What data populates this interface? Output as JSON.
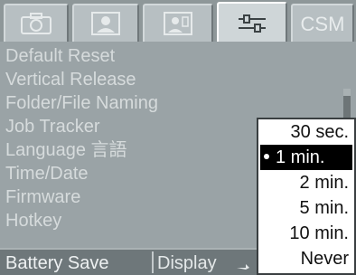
{
  "tabs": [
    {
      "icon": "camera-icon"
    },
    {
      "icon": "portrait-icon"
    },
    {
      "icon": "scene-icon"
    },
    {
      "icon": "settings-icon"
    },
    {
      "label": "CSM"
    }
  ],
  "active_tab": 3,
  "menu": {
    "items": [
      "Default Reset",
      "Vertical Release",
      "Folder/File Naming",
      "Job Tracker",
      "Language 言語",
      "Time/Date",
      "Firmware",
      "Hotkey"
    ],
    "selected_item": "Battery Save",
    "selected_value": "Display"
  },
  "popup": {
    "options": [
      "30 sec.",
      "1 min.",
      "2 min.",
      "5 min.",
      "10 min.",
      "Never"
    ],
    "selected_index": 1
  }
}
